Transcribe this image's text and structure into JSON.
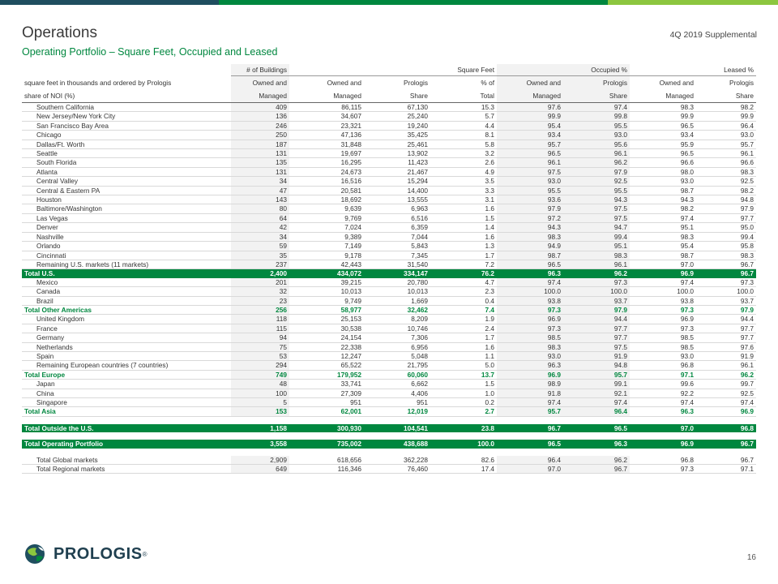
{
  "header": {
    "title": "Operations",
    "subtitle": "Operating Portfolio – Square Feet, Occupied and Leased",
    "supplemental": "4Q 2019 Supplemental",
    "bar_colors": [
      "#1f4e5f",
      "#00873f",
      "#8cc63f"
    ]
  },
  "table": {
    "group_headers": {
      "buildings": "# of Buildings",
      "square_feet": "Square Feet",
      "occupied": "Occupied %",
      "leased": "Leased %"
    },
    "label_line1": "square feet in thousands and ordered by Prologis",
    "label_line2": "share of NOI (%)",
    "column_headers_top": [
      "Owned and",
      "Owned and",
      "Prologis",
      "% of",
      "Owned and",
      "Prologis",
      "Owned and",
      "Prologis"
    ],
    "column_headers_bottom": [
      "Managed",
      "Managed",
      "Share",
      "Total",
      "Managed",
      "Share",
      "Managed",
      "Share"
    ],
    "rows": [
      {
        "type": "body",
        "label": "Southern California",
        "values": [
          "409",
          "86,115",
          "67,130",
          "15.3",
          "97.6",
          "97.4",
          "98.3",
          "98.2"
        ]
      },
      {
        "type": "body",
        "label": "New Jersey/New York City",
        "values": [
          "136",
          "34,607",
          "25,240",
          "5.7",
          "99.9",
          "99.8",
          "99.9",
          "99.9"
        ]
      },
      {
        "type": "body",
        "label": "San Francisco Bay Area",
        "values": [
          "246",
          "23,321",
          "19,240",
          "4.4",
          "95.4",
          "95.5",
          "96.5",
          "96.4"
        ]
      },
      {
        "type": "body",
        "label": "Chicago",
        "values": [
          "250",
          "47,136",
          "35,425",
          "8.1",
          "93.4",
          "93.0",
          "93.4",
          "93.0"
        ]
      },
      {
        "type": "body",
        "label": "Dallas/Ft. Worth",
        "values": [
          "187",
          "31,848",
          "25,461",
          "5.8",
          "95.7",
          "95.6",
          "95.9",
          "95.7"
        ]
      },
      {
        "type": "body",
        "label": "Seattle",
        "values": [
          "131",
          "19,697",
          "13,902",
          "3.2",
          "96.5",
          "96.1",
          "96.5",
          "96.1"
        ]
      },
      {
        "type": "body",
        "label": "South Florida",
        "values": [
          "135",
          "16,295",
          "11,423",
          "2.6",
          "96.1",
          "96.2",
          "96.6",
          "96.6"
        ]
      },
      {
        "type": "body",
        "label": "Atlanta",
        "values": [
          "131",
          "24,673",
          "21,467",
          "4.9",
          "97.5",
          "97.9",
          "98.0",
          "98.3"
        ]
      },
      {
        "type": "body",
        "label": "Central Valley",
        "values": [
          "34",
          "16,516",
          "15,294",
          "3.5",
          "93.0",
          "92.5",
          "93.0",
          "92.5"
        ]
      },
      {
        "type": "body",
        "label": "Central & Eastern PA",
        "values": [
          "47",
          "20,581",
          "14,400",
          "3.3",
          "95.5",
          "95.5",
          "98.7",
          "98.2"
        ]
      },
      {
        "type": "body",
        "label": "Houston",
        "values": [
          "143",
          "18,692",
          "13,555",
          "3.1",
          "93.6",
          "94.3",
          "94.3",
          "94.8"
        ]
      },
      {
        "type": "body",
        "label": "Baltimore/Washington",
        "values": [
          "80",
          "9,639",
          "6,963",
          "1.6",
          "97.9",
          "97.5",
          "98.2",
          "97.9"
        ]
      },
      {
        "type": "body",
        "label": "Las Vegas",
        "values": [
          "64",
          "9,769",
          "6,516",
          "1.5",
          "97.2",
          "97.5",
          "97.4",
          "97.7"
        ]
      },
      {
        "type": "body",
        "label": "Denver",
        "values": [
          "42",
          "7,024",
          "6,359",
          "1.4",
          "94.3",
          "94.7",
          "95.1",
          "95.0"
        ]
      },
      {
        "type": "body",
        "label": "Nashville",
        "values": [
          "34",
          "9,389",
          "7,044",
          "1.6",
          "98.3",
          "99.4",
          "98.3",
          "99.4"
        ]
      },
      {
        "type": "body",
        "label": "Orlando",
        "values": [
          "59",
          "7,149",
          "5,843",
          "1.3",
          "94.9",
          "95.1",
          "95.4",
          "95.8"
        ]
      },
      {
        "type": "body",
        "label": "Cincinnati",
        "values": [
          "35",
          "9,178",
          "7,345",
          "1.7",
          "98.7",
          "98.3",
          "98.7",
          "98.3"
        ]
      },
      {
        "type": "body",
        "label": "Remaining U.S. markets (11 markets)",
        "values": [
          "237",
          "42,443",
          "31,540",
          "7.2",
          "96.5",
          "96.1",
          "97.0",
          "96.7"
        ]
      },
      {
        "type": "total",
        "label": "Total U.S.",
        "values": [
          "2,400",
          "434,072",
          "334,147",
          "76.2",
          "96.3",
          "96.2",
          "96.9",
          "96.7"
        ]
      },
      {
        "type": "body",
        "label": "Mexico",
        "values": [
          "201",
          "39,215",
          "20,780",
          "4.7",
          "97.4",
          "97.3",
          "97.4",
          "97.3"
        ]
      },
      {
        "type": "body",
        "label": "Canada",
        "values": [
          "32",
          "10,013",
          "10,013",
          "2.3",
          "100.0",
          "100.0",
          "100.0",
          "100.0"
        ]
      },
      {
        "type": "body",
        "label": "Brazil",
        "values": [
          "23",
          "9,749",
          "1,669",
          "0.4",
          "93.8",
          "93.7",
          "93.8",
          "93.7"
        ]
      },
      {
        "type": "sub",
        "label": "Total Other Americas",
        "values": [
          "256",
          "58,977",
          "32,462",
          "7.4",
          "97.3",
          "97.9",
          "97.3",
          "97.9"
        ]
      },
      {
        "type": "body",
        "label": "United Kingdom",
        "values": [
          "118",
          "25,153",
          "8,209",
          "1.9",
          "96.9",
          "94.4",
          "96.9",
          "94.4"
        ]
      },
      {
        "type": "body",
        "label": "France",
        "values": [
          "115",
          "30,538",
          "10,746",
          "2.4",
          "97.3",
          "97.7",
          "97.3",
          "97.7"
        ]
      },
      {
        "type": "body",
        "label": "Germany",
        "values": [
          "94",
          "24,154",
          "7,306",
          "1.7",
          "98.5",
          "97.7",
          "98.5",
          "97.7"
        ]
      },
      {
        "type": "body",
        "label": "Netherlands",
        "values": [
          "75",
          "22,338",
          "6,956",
          "1.6",
          "98.3",
          "97.5",
          "98.5",
          "97.6"
        ]
      },
      {
        "type": "body",
        "label": "Spain",
        "values": [
          "53",
          "12,247",
          "5,048",
          "1.1",
          "93.0",
          "91.9",
          "93.0",
          "91.9"
        ]
      },
      {
        "type": "body",
        "label": "Remaining European countries (7 countries)",
        "values": [
          "294",
          "65,522",
          "21,795",
          "5.0",
          "96.3",
          "94.8",
          "96.8",
          "96.1"
        ]
      },
      {
        "type": "sub",
        "label": "Total Europe",
        "values": [
          "749",
          "179,952",
          "60,060",
          "13.7",
          "96.9",
          "95.7",
          "97.1",
          "96.2"
        ]
      },
      {
        "type": "body",
        "label": "Japan",
        "values": [
          "48",
          "33,741",
          "6,662",
          "1.5",
          "98.9",
          "99.1",
          "99.6",
          "99.7"
        ]
      },
      {
        "type": "body",
        "label": "China",
        "values": [
          "100",
          "27,309",
          "4,406",
          "1.0",
          "91.8",
          "92.1",
          "92.2",
          "92.5"
        ]
      },
      {
        "type": "body",
        "label": "Singapore",
        "values": [
          "5",
          "951",
          "951",
          "0.2",
          "97.4",
          "97.4",
          "97.4",
          "97.4"
        ]
      },
      {
        "type": "sub",
        "label": "Total Asia",
        "values": [
          "153",
          "62,001",
          "12,019",
          "2.7",
          "95.7",
          "96.4",
          "96.3",
          "96.9"
        ]
      },
      {
        "type": "spacer"
      },
      {
        "type": "total",
        "label": "Total Outside the U.S.",
        "values": [
          "1,158",
          "300,930",
          "104,541",
          "23.8",
          "96.7",
          "96.5",
          "97.0",
          "96.8"
        ]
      },
      {
        "type": "spacer"
      },
      {
        "type": "total",
        "label": "Total Operating Portfolio",
        "values": [
          "3,558",
          "735,002",
          "438,688",
          "100.0",
          "96.5",
          "96.3",
          "96.9",
          "96.7"
        ]
      },
      {
        "type": "spacer"
      },
      {
        "type": "body",
        "label": "Total Global markets",
        "values": [
          "2,909",
          "618,656",
          "362,228",
          "82.6",
          "96.4",
          "96.2",
          "96.8",
          "96.7"
        ]
      },
      {
        "type": "body",
        "label": "Total Regional markets",
        "values": [
          "649",
          "116,346",
          "76,460",
          "17.4",
          "97.0",
          "96.7",
          "97.3",
          "97.1"
        ]
      }
    ]
  },
  "footer": {
    "logo_text": "PROLOGIS",
    "logo_mark": "®",
    "page_number": "16",
    "logo_colors": [
      "#1f4e5f",
      "#00873f",
      "#8cc63f"
    ]
  }
}
